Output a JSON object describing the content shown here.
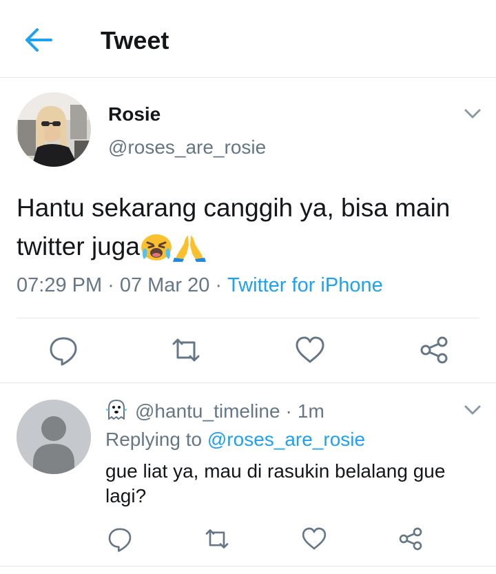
{
  "header": {
    "title": "Tweet"
  },
  "tweet": {
    "author_name": "Rosie",
    "author_handle": "@roses_are_rosie",
    "text": "Hantu sekarang canggih ya, bisa main twitter juga",
    "emojis": [
      "crying-face-emoji",
      "folded-hands-emoji"
    ],
    "time": "07:29 PM",
    "date": "07 Mar 20",
    "separator": "·",
    "source": "Twitter for iPhone"
  },
  "reply": {
    "handle": "@hantu_timeline",
    "separator": "·",
    "time": "1m",
    "replying_prefix": "Replying to",
    "replying_to": "@roses_are_rosie",
    "text": "gue liat ya, mau di rasukin belalang gue lagi?"
  },
  "colors": {
    "accent": "#1da1f2",
    "muted": "#657786",
    "text": "#14171a",
    "divider": "#e1e8ed"
  }
}
